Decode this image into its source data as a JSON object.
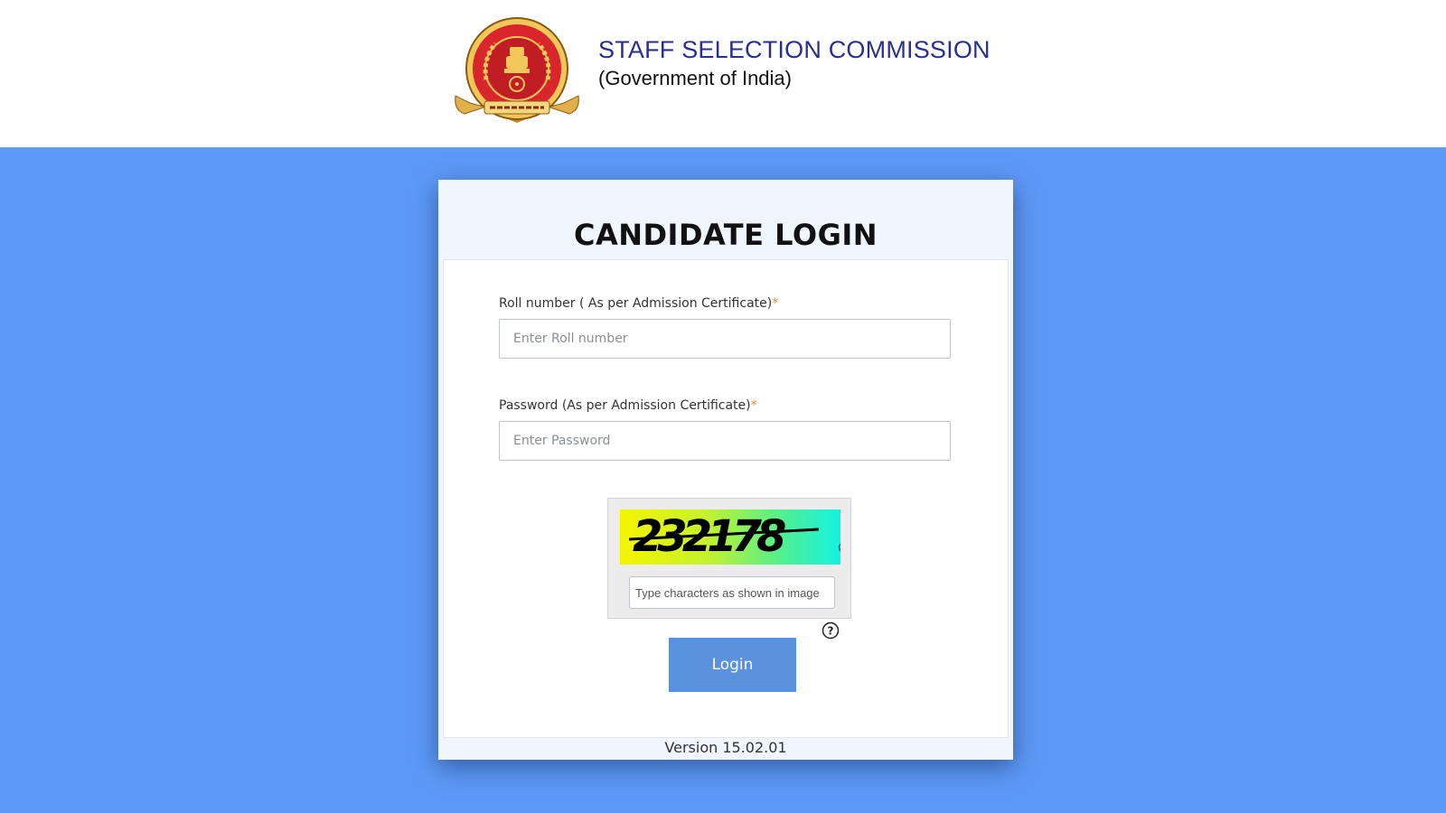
{
  "header": {
    "title": "STAFF SELECTION COMMISSION",
    "subtitle": "(Government of India)"
  },
  "login": {
    "title": "CANDIDATE LOGIN",
    "roll": {
      "label": "Roll number ( As per Admission Certificate)",
      "required_mark": "*",
      "placeholder": "Enter Roll number"
    },
    "password": {
      "label": "Password (As per Admission Certificate)",
      "required_mark": "*",
      "placeholder": "Enter Password"
    },
    "captcha": {
      "code": "232178",
      "placeholder": "Type characters as shown in image",
      "refresh_icon": "refresh-icon",
      "help_icon": "help-icon"
    },
    "login_label": "Login",
    "version": "Version 15.02.01"
  },
  "colors": {
    "background": "#5d99f7",
    "header_text": "#2a2f8f",
    "button": "#5b92df",
    "required": "#f08a24"
  }
}
